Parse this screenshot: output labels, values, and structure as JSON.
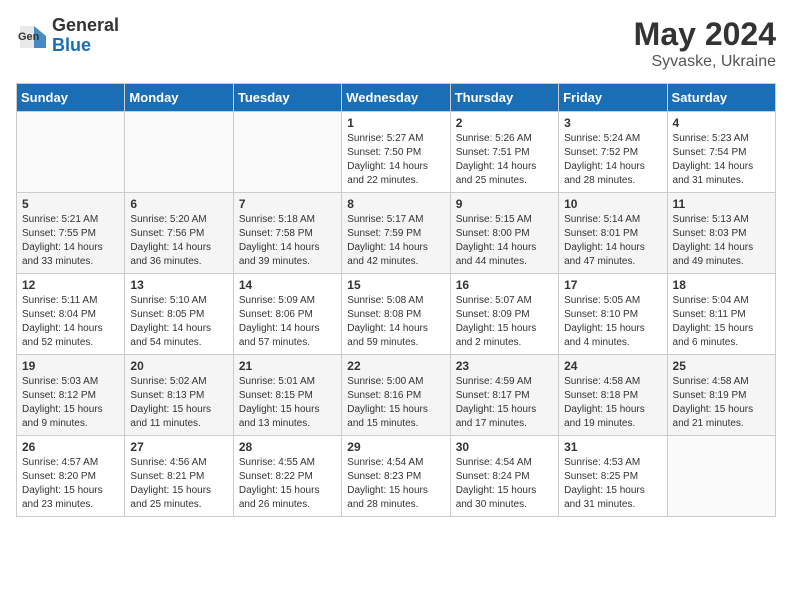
{
  "header": {
    "logo_general": "General",
    "logo_blue": "Blue",
    "month": "May 2024",
    "location": "Syvaske, Ukraine"
  },
  "weekdays": [
    "Sunday",
    "Monday",
    "Tuesday",
    "Wednesday",
    "Thursday",
    "Friday",
    "Saturday"
  ],
  "weeks": [
    [
      {
        "day": "",
        "info": ""
      },
      {
        "day": "",
        "info": ""
      },
      {
        "day": "",
        "info": ""
      },
      {
        "day": "1",
        "info": "Sunrise: 5:27 AM\nSunset: 7:50 PM\nDaylight: 14 hours\nand 22 minutes."
      },
      {
        "day": "2",
        "info": "Sunrise: 5:26 AM\nSunset: 7:51 PM\nDaylight: 14 hours\nand 25 minutes."
      },
      {
        "day": "3",
        "info": "Sunrise: 5:24 AM\nSunset: 7:52 PM\nDaylight: 14 hours\nand 28 minutes."
      },
      {
        "day": "4",
        "info": "Sunrise: 5:23 AM\nSunset: 7:54 PM\nDaylight: 14 hours\nand 31 minutes."
      }
    ],
    [
      {
        "day": "5",
        "info": "Sunrise: 5:21 AM\nSunset: 7:55 PM\nDaylight: 14 hours\nand 33 minutes."
      },
      {
        "day": "6",
        "info": "Sunrise: 5:20 AM\nSunset: 7:56 PM\nDaylight: 14 hours\nand 36 minutes."
      },
      {
        "day": "7",
        "info": "Sunrise: 5:18 AM\nSunset: 7:58 PM\nDaylight: 14 hours\nand 39 minutes."
      },
      {
        "day": "8",
        "info": "Sunrise: 5:17 AM\nSunset: 7:59 PM\nDaylight: 14 hours\nand 42 minutes."
      },
      {
        "day": "9",
        "info": "Sunrise: 5:15 AM\nSunset: 8:00 PM\nDaylight: 14 hours\nand 44 minutes."
      },
      {
        "day": "10",
        "info": "Sunrise: 5:14 AM\nSunset: 8:01 PM\nDaylight: 14 hours\nand 47 minutes."
      },
      {
        "day": "11",
        "info": "Sunrise: 5:13 AM\nSunset: 8:03 PM\nDaylight: 14 hours\nand 49 minutes."
      }
    ],
    [
      {
        "day": "12",
        "info": "Sunrise: 5:11 AM\nSunset: 8:04 PM\nDaylight: 14 hours\nand 52 minutes."
      },
      {
        "day": "13",
        "info": "Sunrise: 5:10 AM\nSunset: 8:05 PM\nDaylight: 14 hours\nand 54 minutes."
      },
      {
        "day": "14",
        "info": "Sunrise: 5:09 AM\nSunset: 8:06 PM\nDaylight: 14 hours\nand 57 minutes."
      },
      {
        "day": "15",
        "info": "Sunrise: 5:08 AM\nSunset: 8:08 PM\nDaylight: 14 hours\nand 59 minutes."
      },
      {
        "day": "16",
        "info": "Sunrise: 5:07 AM\nSunset: 8:09 PM\nDaylight: 15 hours\nand 2 minutes."
      },
      {
        "day": "17",
        "info": "Sunrise: 5:05 AM\nSunset: 8:10 PM\nDaylight: 15 hours\nand 4 minutes."
      },
      {
        "day": "18",
        "info": "Sunrise: 5:04 AM\nSunset: 8:11 PM\nDaylight: 15 hours\nand 6 minutes."
      }
    ],
    [
      {
        "day": "19",
        "info": "Sunrise: 5:03 AM\nSunset: 8:12 PM\nDaylight: 15 hours\nand 9 minutes."
      },
      {
        "day": "20",
        "info": "Sunrise: 5:02 AM\nSunset: 8:13 PM\nDaylight: 15 hours\nand 11 minutes."
      },
      {
        "day": "21",
        "info": "Sunrise: 5:01 AM\nSunset: 8:15 PM\nDaylight: 15 hours\nand 13 minutes."
      },
      {
        "day": "22",
        "info": "Sunrise: 5:00 AM\nSunset: 8:16 PM\nDaylight: 15 hours\nand 15 minutes."
      },
      {
        "day": "23",
        "info": "Sunrise: 4:59 AM\nSunset: 8:17 PM\nDaylight: 15 hours\nand 17 minutes."
      },
      {
        "day": "24",
        "info": "Sunrise: 4:58 AM\nSunset: 8:18 PM\nDaylight: 15 hours\nand 19 minutes."
      },
      {
        "day": "25",
        "info": "Sunrise: 4:58 AM\nSunset: 8:19 PM\nDaylight: 15 hours\nand 21 minutes."
      }
    ],
    [
      {
        "day": "26",
        "info": "Sunrise: 4:57 AM\nSunset: 8:20 PM\nDaylight: 15 hours\nand 23 minutes."
      },
      {
        "day": "27",
        "info": "Sunrise: 4:56 AM\nSunset: 8:21 PM\nDaylight: 15 hours\nand 25 minutes."
      },
      {
        "day": "28",
        "info": "Sunrise: 4:55 AM\nSunset: 8:22 PM\nDaylight: 15 hours\nand 26 minutes."
      },
      {
        "day": "29",
        "info": "Sunrise: 4:54 AM\nSunset: 8:23 PM\nDaylight: 15 hours\nand 28 minutes."
      },
      {
        "day": "30",
        "info": "Sunrise: 4:54 AM\nSunset: 8:24 PM\nDaylight: 15 hours\nand 30 minutes."
      },
      {
        "day": "31",
        "info": "Sunrise: 4:53 AM\nSunset: 8:25 PM\nDaylight: 15 hours\nand 31 minutes."
      },
      {
        "day": "",
        "info": ""
      }
    ]
  ]
}
